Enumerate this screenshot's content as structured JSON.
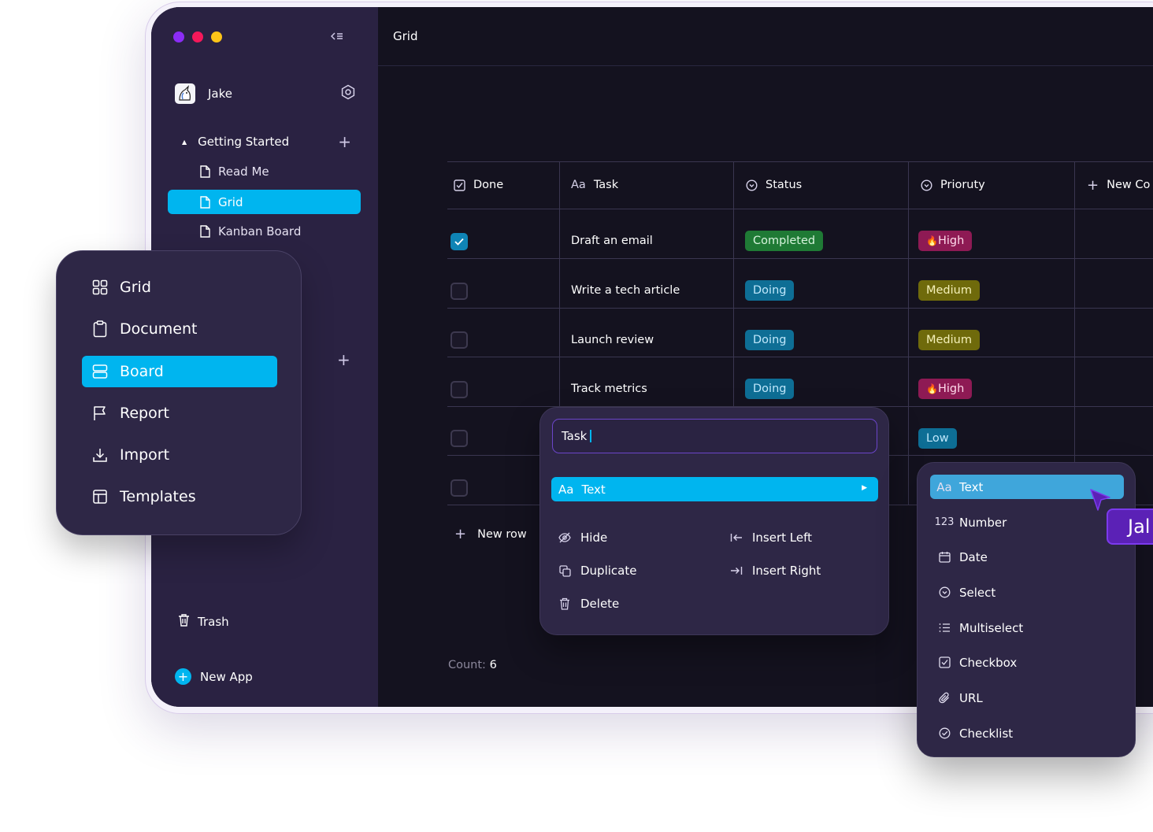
{
  "window": {
    "dots": [
      "#8b2cf5",
      "#f5185a",
      "#fcc418"
    ]
  },
  "sidebar": {
    "user_name": "Jake",
    "folder_label": "Getting Started",
    "pages": [
      {
        "label": "Read Me"
      },
      {
        "label": "Grid",
        "active": true
      },
      {
        "label": "Kanban Board"
      }
    ],
    "trash_label": "Trash",
    "new_app_label": "New App"
  },
  "views_menu": {
    "items": [
      {
        "label": "Grid",
        "icon": "grid-icon"
      },
      {
        "label": "Document",
        "icon": "clipboard-icon"
      },
      {
        "label": "Board",
        "icon": "board-icon",
        "active": true
      },
      {
        "label": "Report",
        "icon": "flag-icon"
      },
      {
        "label": "Import",
        "icon": "download-icon"
      },
      {
        "label": "Templates",
        "icon": "template-icon"
      }
    ]
  },
  "main": {
    "title": "Grid",
    "columns": [
      {
        "label": "Done",
        "icon": "checkbox-icon"
      },
      {
        "label": "Task",
        "icon": "text-type-icon",
        "prefix": "Aa"
      },
      {
        "label": "Status",
        "icon": "select-icon"
      },
      {
        "label": "Prioruty",
        "icon": "select-icon"
      },
      {
        "label": "New Co",
        "icon": "plus-icon"
      }
    ],
    "rows": [
      {
        "done": true,
        "task": "Draft an email",
        "status": "Completed",
        "priority": "High"
      },
      {
        "done": false,
        "task": "Write a tech article",
        "status": "Doing",
        "priority": "Medium"
      },
      {
        "done": false,
        "task": "Launch review",
        "status": "Doing",
        "priority": "Medium"
      },
      {
        "done": false,
        "task": "Track metrics",
        "status": "Doing",
        "priority": "High"
      },
      {
        "done": false,
        "task": "",
        "status": "",
        "priority": "Low"
      },
      {
        "done": false,
        "task": "",
        "status": "",
        "priority": ""
      }
    ],
    "new_row_label": "New row",
    "count_label": "Count:",
    "count_value": "6"
  },
  "column_menu": {
    "name_value": "Task",
    "type_prefix": "Aa",
    "type_label": "Text",
    "actions": {
      "hide": "Hide",
      "insert_left": "Insert Left",
      "duplicate": "Duplicate",
      "insert_right": "Insert Right",
      "delete": "Delete"
    }
  },
  "type_menu": {
    "items": [
      {
        "label": "Text",
        "icon": "text-type-icon",
        "glyph": "Aa",
        "active": true
      },
      {
        "label": "Number",
        "icon": "number-icon",
        "glyph": "123"
      },
      {
        "label": "Date",
        "icon": "calendar-icon"
      },
      {
        "label": "Select",
        "icon": "select-icon"
      },
      {
        "label": "Multiselect",
        "icon": "list-icon"
      },
      {
        "label": "Checkbox",
        "icon": "checkbox-icon"
      },
      {
        "label": "URL",
        "icon": "paperclip-icon"
      },
      {
        "label": "Checklist",
        "icon": "check-circle-icon"
      }
    ]
  },
  "collaborator": {
    "label": "Jal"
  },
  "colors": {
    "accent": "#00b5ef",
    "sidebar": "#2a2242",
    "main_bg": "#14121f",
    "menu_bg": "#2e2746",
    "cursor": "#5b21b6"
  }
}
